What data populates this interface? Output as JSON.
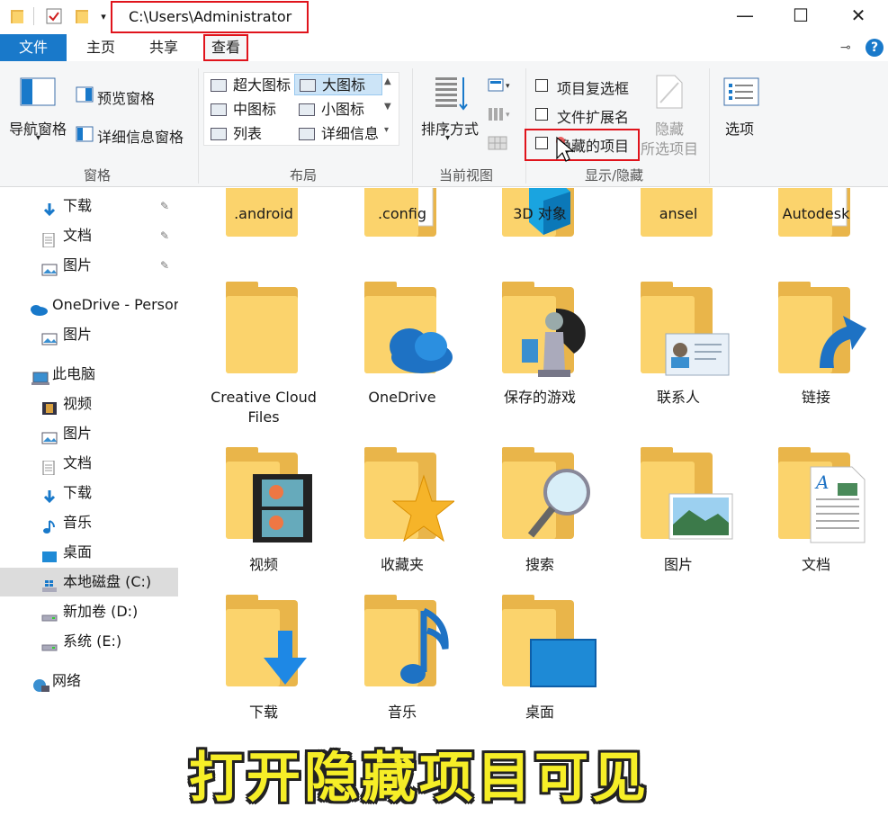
{
  "titlebar": {
    "path": "C:\\Users\\Administrator",
    "minimize_glyph": "—",
    "maximize_glyph": "☐",
    "close_glyph": "✕"
  },
  "tabs": [
    {
      "label": "文件"
    },
    {
      "label": "主页"
    },
    {
      "label": "共享"
    },
    {
      "label": "查看"
    }
  ],
  "ribbon": {
    "pane_group": {
      "nav_pane": "导航窗格",
      "preview_pane": "预览窗格",
      "details_pane": "详细信息窗格",
      "label": "窗格"
    },
    "layout_group": {
      "items": [
        "超大图标",
        "大图标",
        "中图标",
        "小图标",
        "列表",
        "详细信息"
      ],
      "selected": "大图标",
      "label": "布局"
    },
    "current_view_group": {
      "sort_by": "排序方式",
      "label": "当前视图"
    },
    "show_hide_group": {
      "item_checkboxes": "项目复选框",
      "file_extensions": "文件扩展名",
      "hidden_items": "隐藏的项目",
      "hide_selected_line1": "隐藏",
      "hide_selected_line2": "所选项目",
      "label": "显示/隐藏"
    },
    "options": "选项"
  },
  "sidebar": {
    "items": [
      {
        "label": "下载",
        "icon": "download-arrow-icon",
        "pinned": true
      },
      {
        "label": "文档",
        "icon": "document-icon",
        "pinned": true
      },
      {
        "label": "图片",
        "icon": "picture-icon",
        "pinned": true
      },
      {
        "label": "OneDrive - Persor",
        "icon": "onedrive-cloud-icon"
      },
      {
        "label": "图片",
        "icon": "picture-icon"
      },
      {
        "label": "此电脑",
        "icon": "computer-icon"
      },
      {
        "label": "视频",
        "icon": "video-icon"
      },
      {
        "label": "图片",
        "icon": "picture-icon"
      },
      {
        "label": "文档",
        "icon": "document-icon"
      },
      {
        "label": "下载",
        "icon": "download-arrow-icon"
      },
      {
        "label": "音乐",
        "icon": "music-note-icon"
      },
      {
        "label": "桌面",
        "icon": "desktop-icon"
      },
      {
        "label": "本地磁盘 (C:)",
        "icon": "windows-drive-icon",
        "selected": true
      },
      {
        "label": "新加卷 (D:)",
        "icon": "drive-icon"
      },
      {
        "label": "系统 (E:)",
        "icon": "drive-icon"
      },
      {
        "label": "网络",
        "icon": "network-icon"
      }
    ],
    "pin_glyph": "📌"
  },
  "content": {
    "items": [
      {
        "label": ".android",
        "overlay": "paper"
      },
      {
        "label": ".config",
        "overlay": "paper"
      },
      {
        "label": "3D 对象",
        "overlay": "3d-cube"
      },
      {
        "label": "ansel",
        "overlay": "none"
      },
      {
        "label": "Autodesk",
        "overlay": "paper"
      },
      {
        "label": "Creative Cloud Files",
        "overlay": "none"
      },
      {
        "label": "OneDrive",
        "overlay": "cloud"
      },
      {
        "label": "保存的游戏",
        "overlay": "chess"
      },
      {
        "label": "联系人",
        "overlay": "contact"
      },
      {
        "label": "链接",
        "overlay": "link-arrow"
      },
      {
        "label": "视频",
        "overlay": "film"
      },
      {
        "label": "收藏夹",
        "overlay": "star"
      },
      {
        "label": "搜索",
        "overlay": "magnifier"
      },
      {
        "label": "图片",
        "overlay": "landscape"
      },
      {
        "label": "文档",
        "overlay": "doc"
      },
      {
        "label": "下载",
        "overlay": "download"
      },
      {
        "label": "音乐",
        "overlay": "music"
      },
      {
        "label": "桌面",
        "overlay": "desktop"
      }
    ]
  },
  "caption": "打开隐藏项目可见",
  "colors": {
    "accent": "#1979ca",
    "highlight": "#e0141c",
    "folder": "#fbd36c",
    "caption": "#f6ee27"
  }
}
